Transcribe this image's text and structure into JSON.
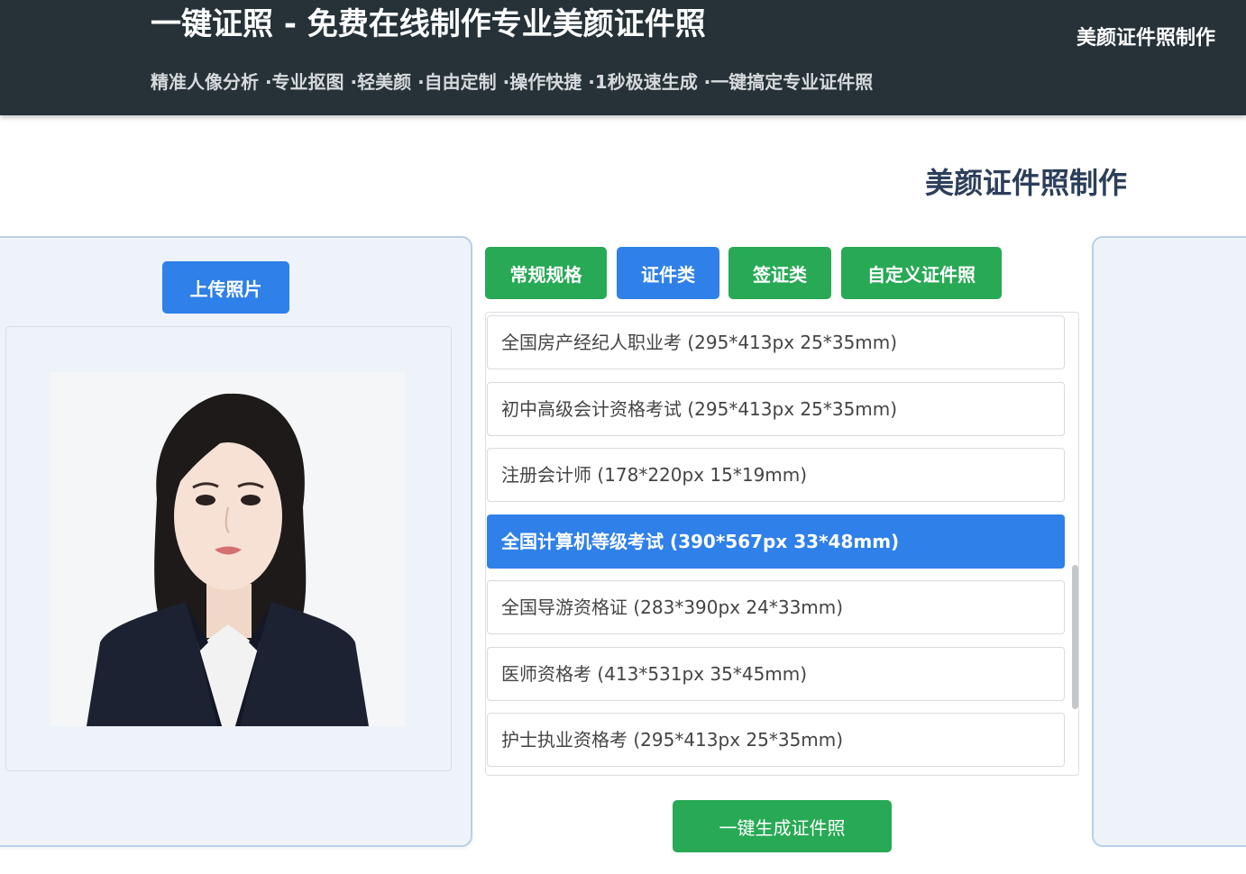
{
  "header": {
    "title": "一键证照 - 免费在线制作专业美颜证件照",
    "subtitle": "精准人像分析 ·专业抠图 ·轻美颜 ·自由定制 ·操作快捷 ·1秒极速生成 ·一键搞定专业证件照",
    "nav_link": "美颜证件照制作"
  },
  "page_heading": "美颜证件照制作",
  "upload": {
    "label": "上传照片"
  },
  "tabs": [
    {
      "label": "常规规格",
      "active": false
    },
    {
      "label": "证件类",
      "active": true
    },
    {
      "label": "签证类",
      "active": false
    },
    {
      "label": "自定义证件照",
      "active": false
    }
  ],
  "spec_list": [
    {
      "label": "全国房产经纪人职业考 (295*413px 25*35mm)",
      "selected": false
    },
    {
      "label": "初中高级会计资格考试 (295*413px 25*35mm)",
      "selected": false
    },
    {
      "label": "注册会计师 (178*220px 15*19mm)",
      "selected": false
    },
    {
      "label": "全国计算机等级考试 (390*567px 33*48mm)",
      "selected": true
    },
    {
      "label": "全国导游资格证 (283*390px 24*33mm)",
      "selected": false
    },
    {
      "label": "医师资格考 (413*531px 35*45mm)",
      "selected": false
    },
    {
      "label": "护士执业资格考 (295*413px 25*35mm)",
      "selected": false
    }
  ],
  "generate": {
    "label": "一键生成证件照"
  },
  "colors": {
    "header_bg": "#263238",
    "primary_blue": "#2f80e9",
    "primary_green": "#28a955",
    "panel_bg": "#eef3fa"
  }
}
